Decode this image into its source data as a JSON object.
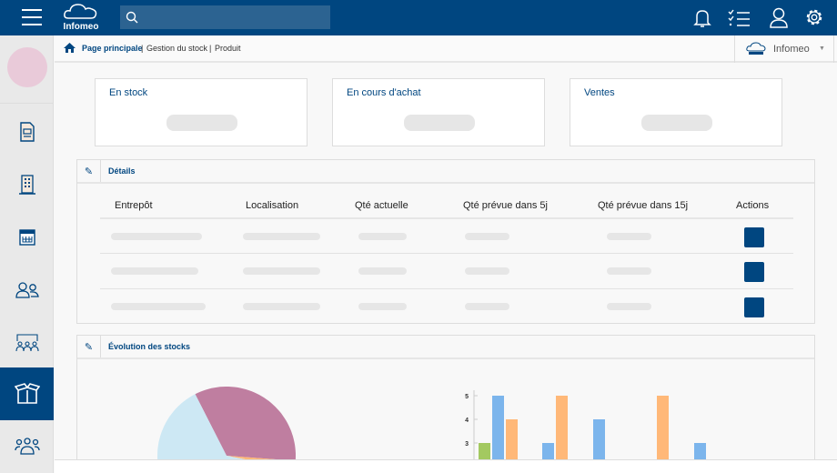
{
  "header": {
    "brand": "Infomeo",
    "search_placeholder": ""
  },
  "breadcrumb": {
    "items": [
      "Page principale",
      "Gestion du stock",
      "Produit"
    ]
  },
  "company": {
    "name": "Infomeo"
  },
  "sidebar": {
    "items": [
      "documents",
      "buildings",
      "calculator",
      "contacts",
      "meetings",
      "stock",
      "groups"
    ],
    "active": "stock"
  },
  "cards": [
    {
      "title": "En stock"
    },
    {
      "title": "En cours d'achat"
    },
    {
      "title": "Ventes"
    }
  ],
  "details": {
    "title": "Détails",
    "columns": [
      "Entrepôt",
      "Localisation",
      "Qté actuelle",
      "Qté prévue dans 5j",
      "Qté prévue dans 15j",
      "Actions"
    ],
    "row_count": 3
  },
  "evolution": {
    "title": "Évolution des stocks"
  },
  "colors": {
    "primary": "#004680",
    "green": "#a3c960",
    "blue": "#7cb5ec",
    "orange": "#ffb878",
    "purple": "#bf7ea0",
    "lightblue": "#cde8f4"
  },
  "chart_data": [
    {
      "type": "pie",
      "slices": [
        {
          "value": 0.4,
          "color": "#bf7ea0"
        },
        {
          "value": 0.12,
          "color": "#ffb878"
        },
        {
          "value": 0.48,
          "color": "#cde8f4"
        }
      ]
    },
    {
      "type": "bar",
      "yticks": [
        3,
        4,
        5
      ],
      "ylim": [
        2,
        5
      ],
      "series": [
        {
          "color": "#a3c960",
          "values": [
            3,
            null,
            null,
            null,
            null
          ]
        },
        {
          "color": "#7cb5ec",
          "values": [
            5,
            3,
            4,
            null,
            3
          ]
        },
        {
          "color": "#ffb878",
          "values": [
            4,
            5,
            null,
            5,
            null
          ]
        }
      ]
    }
  ]
}
